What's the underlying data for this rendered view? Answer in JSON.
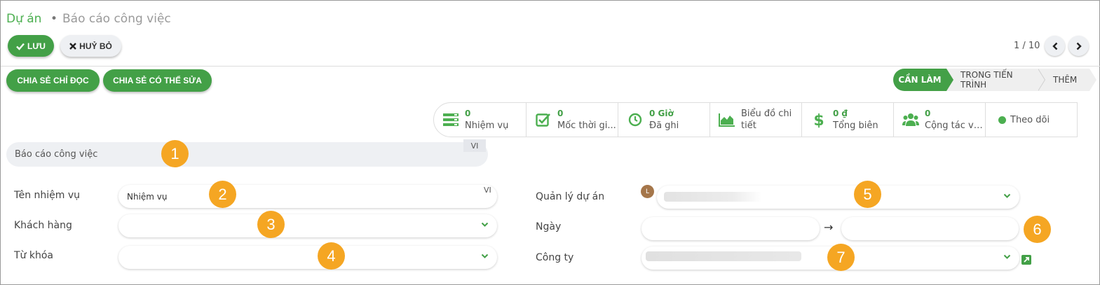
{
  "breadcrumb": {
    "root": "Dự án",
    "separator": "•",
    "current": "Báo cáo công việc"
  },
  "toolbar": {
    "save_label": "LƯU",
    "cancel_label": "HUỶ BỎ"
  },
  "pager": {
    "text": "1 / 10"
  },
  "share": {
    "read_only_label": "CHIA SẺ CHỈ ĐỌC",
    "editable_label": "CHIA SẺ CÓ THỂ SỬA"
  },
  "stages": [
    {
      "label": "CẦN LÀM",
      "active": true
    },
    {
      "label": "TRONG TIẾN TRÌNH",
      "active": false
    },
    {
      "label": "THÊM",
      "active": false
    }
  ],
  "stats": {
    "tasks": {
      "value": "0",
      "label": "Nhiệm vụ",
      "icon": "tasks-icon"
    },
    "milestones": {
      "value": "0",
      "label": "Mốc thời gi...",
      "icon": "checkbox-icon"
    },
    "hours": {
      "value": "0 Giờ",
      "label": "Đã ghi",
      "icon": "clock-icon"
    },
    "burndown": {
      "label": "Biểu đồ chi tiết",
      "icon": "area-chart-icon"
    },
    "margin": {
      "value": "0 ₫",
      "label": "Tổng biên",
      "icon": "dollar-icon"
    },
    "collaborators": {
      "value": "0",
      "label": "Cộng tác vi...",
      "icon": "users-icon"
    },
    "follow": {
      "label": "Theo dõi"
    }
  },
  "form": {
    "name_value": "Báo cáo công việc",
    "lang_code": "VI",
    "task_label": "Tên nhiệm vụ",
    "task_value": "Nhiệm vụ",
    "customer_label": "Khách hàng",
    "tags_label": "Từ khóa",
    "manager_label": "Quản lý dự án",
    "manager_avatar": "L",
    "date_label": "Ngày",
    "date_arrow": "→",
    "company_label": "Công ty"
  },
  "markers": [
    "1",
    "2",
    "3",
    "4",
    "5",
    "6",
    "7"
  ],
  "colors": {
    "primary": "#43a047",
    "marker": "#f5a623"
  }
}
